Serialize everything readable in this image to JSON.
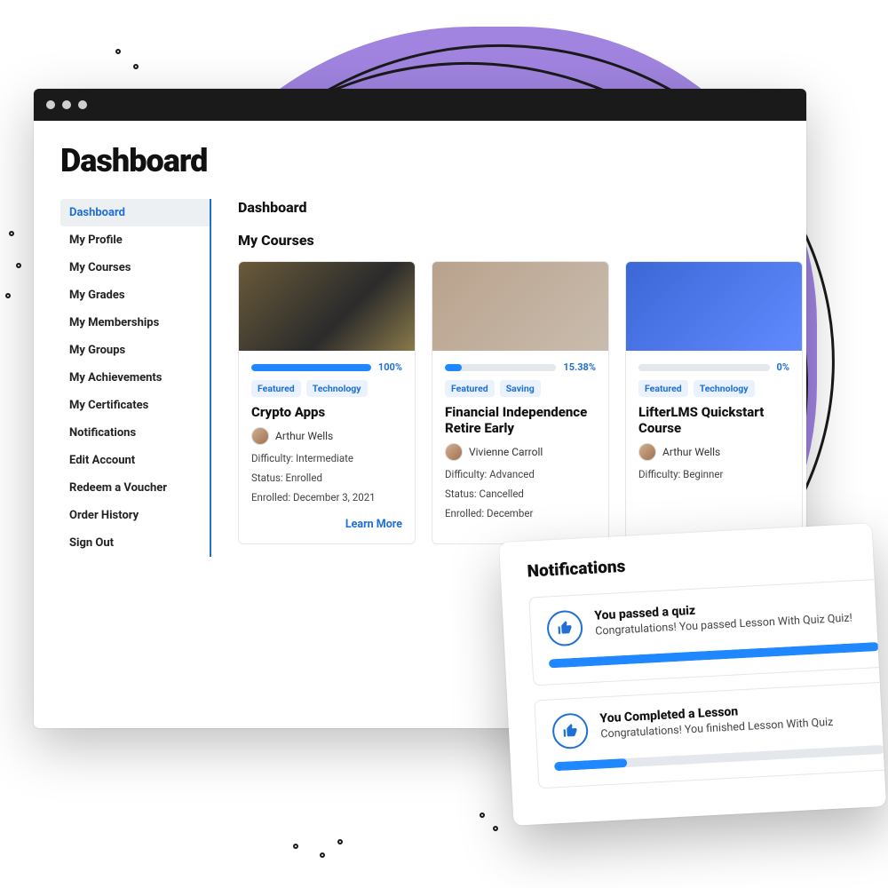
{
  "page": {
    "title": "Dashboard"
  },
  "sidebar": {
    "items": [
      {
        "label": "Dashboard",
        "active": true
      },
      {
        "label": "My Profile"
      },
      {
        "label": "My Courses"
      },
      {
        "label": "My Grades"
      },
      {
        "label": "My Memberships"
      },
      {
        "label": "My Groups"
      },
      {
        "label": "My Achievements"
      },
      {
        "label": "My Certificates"
      },
      {
        "label": "Notifications"
      },
      {
        "label": "Edit Account"
      },
      {
        "label": "Redeem a Voucher"
      },
      {
        "label": "Order History"
      },
      {
        "label": "Sign Out"
      }
    ]
  },
  "main": {
    "heading": "Dashboard",
    "courses_heading": "My Courses",
    "learn_more_label": "Learn More",
    "courses": [
      {
        "progress": 100,
        "progress_label": "100%",
        "tags": [
          "Featured",
          "Technology"
        ],
        "title": "Crypto Apps",
        "author": "Arthur Wells",
        "difficulty": "Difficulty: Intermediate",
        "status": "Status: Enrolled",
        "enrolled": "Enrolled: December 3, 2021"
      },
      {
        "progress": 15.38,
        "progress_label": "15.38%",
        "tags": [
          "Featured",
          "Saving"
        ],
        "title": "Financial Independence Retire Early",
        "author": "Vivienne Carroll",
        "difficulty": "Difficulty: Advanced",
        "status": "Status: Cancelled",
        "enrolled": "Enrolled: December"
      },
      {
        "progress": 0,
        "progress_label": "0%",
        "tags": [
          "Featured",
          "Technology"
        ],
        "title": "LifterLMS Quickstart Course",
        "author": "Arthur Wells",
        "difficulty": "Difficulty: Beginner",
        "status": "",
        "enrolled": ""
      }
    ]
  },
  "notifications": {
    "title": "Notifications",
    "items": [
      {
        "title": "You passed a quiz",
        "body": "Congratulations! You passed Lesson With Quiz Quiz!",
        "progress": 100
      },
      {
        "title": "You Completed a Lesson",
        "body": "Congratulations! You finished Lesson With Quiz",
        "progress": 22
      }
    ]
  }
}
